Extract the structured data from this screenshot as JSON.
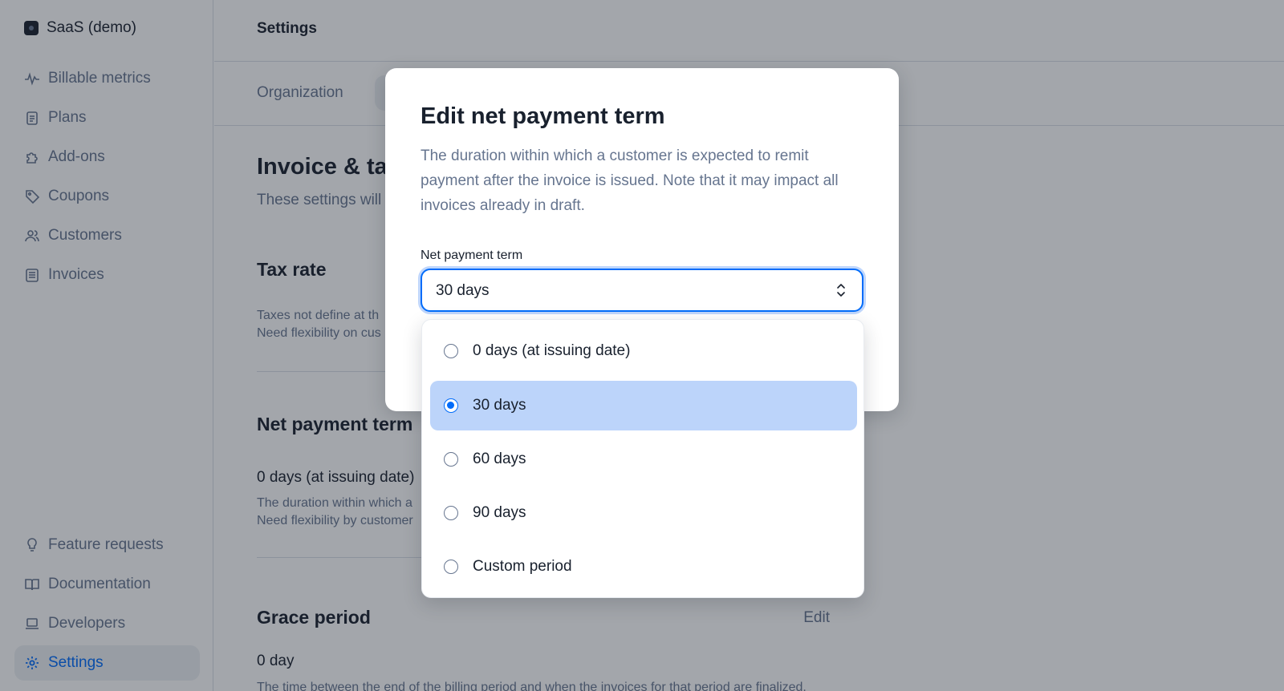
{
  "sidebar": {
    "org_name": "SaaS (demo)",
    "top_items": [
      {
        "label": "Billable metrics",
        "icon": "pulse-icon"
      },
      {
        "label": "Plans",
        "icon": "clipboard-icon"
      },
      {
        "label": "Add-ons",
        "icon": "puzzle-icon"
      },
      {
        "label": "Coupons",
        "icon": "tag-icon"
      },
      {
        "label": "Customers",
        "icon": "users-icon"
      },
      {
        "label": "Invoices",
        "icon": "document-icon"
      }
    ],
    "bottom_items": [
      {
        "label": "Feature requests",
        "icon": "lightbulb-icon"
      },
      {
        "label": "Documentation",
        "icon": "book-icon"
      },
      {
        "label": "Developers",
        "icon": "laptop-icon"
      },
      {
        "label": "Settings",
        "icon": "gear-icon",
        "active": true
      }
    ]
  },
  "header": {
    "title": "Settings"
  },
  "tabs": {
    "organization": "Organization"
  },
  "page": {
    "title": "Invoice & tax",
    "subtitle": "These settings will",
    "tax_rate": {
      "title": "Tax rate",
      "line1": "Taxes not define at th",
      "line2": "Need flexibility on cus"
    },
    "net_payment_term": {
      "title": "Net payment term",
      "value": "0 days (at issuing date)",
      "line1": "The duration within which a",
      "line2": "Need flexibility by customer"
    },
    "grace_period": {
      "title": "Grace period",
      "edit": "Edit",
      "value": "0 day",
      "line1": "The time between the end of the billing period and when the invoices for that period are finalized."
    }
  },
  "dialog": {
    "title": "Edit net payment term",
    "description": "The duration within which a customer is expected to remit payment after the invoice is issued. Note that it may impact all invoices already in draft.",
    "field_label": "Net payment term",
    "selected_value": "30 days",
    "options": [
      {
        "label": "0 days (at issuing date)",
        "selected": false
      },
      {
        "label": "30 days",
        "selected": true
      },
      {
        "label": "60 days",
        "selected": false
      },
      {
        "label": "90 days",
        "selected": false
      },
      {
        "label": "Custom period",
        "selected": false
      }
    ]
  },
  "colors": {
    "accent": "#006cfa",
    "selected_option_bg": "#bcd4fa",
    "overlay": "rgba(25,33,46,0.4)"
  }
}
